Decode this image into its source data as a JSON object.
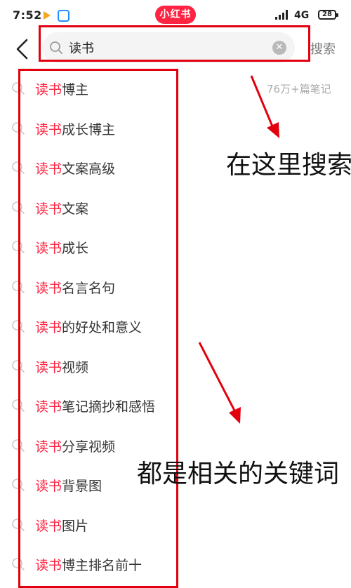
{
  "status_bar": {
    "time": "7:52",
    "app_badge": "小红书",
    "network": "4G",
    "battery": "28"
  },
  "search": {
    "query": "读书",
    "search_label": "搜索"
  },
  "suggestions": [
    {
      "keyword": "读书",
      "rest": "博主",
      "count": "76万+篇笔记"
    },
    {
      "keyword": "读书",
      "rest": "成长博主"
    },
    {
      "keyword": "读书",
      "rest": "文案高级"
    },
    {
      "keyword": "读书",
      "rest": "文案"
    },
    {
      "keyword": "读书",
      "rest": "成长"
    },
    {
      "keyword": "读书",
      "rest": "名言名句"
    },
    {
      "keyword": "读书",
      "rest": "的好处和意义"
    },
    {
      "keyword": "读书",
      "rest": "视频"
    },
    {
      "keyword": "读书",
      "rest": "笔记摘抄和感悟"
    },
    {
      "keyword": "读书",
      "rest": "分享视频"
    },
    {
      "keyword": "读书",
      "rest": "背景图"
    },
    {
      "keyword": "读书",
      "rest": "图片"
    },
    {
      "keyword": "读书",
      "rest": "博主排名前十"
    }
  ],
  "annotations": {
    "search_hint": "在这里搜索",
    "list_hint": "都是相关的关键词"
  },
  "colors": {
    "brand_red": "#ff2442",
    "annotation_red": "#e3000e"
  },
  "icons": {
    "back": "chevron-left-icon",
    "search": "search-icon",
    "clear": "clear-icon"
  }
}
